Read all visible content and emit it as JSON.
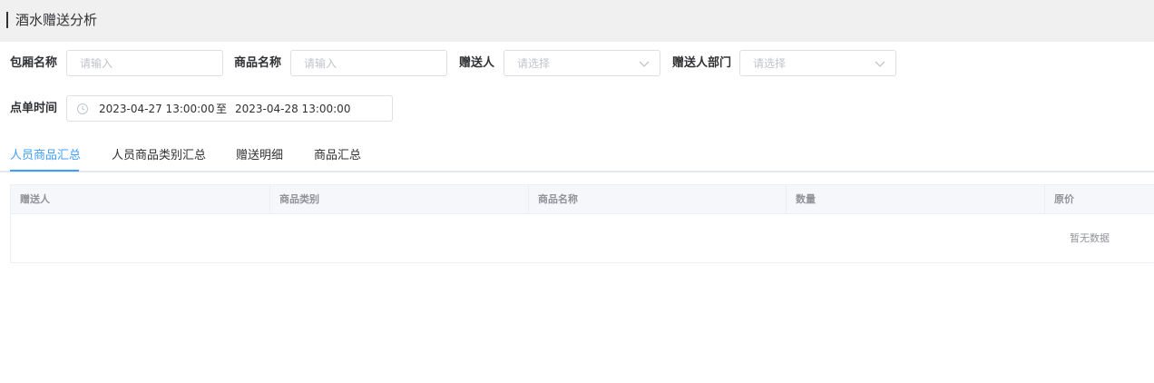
{
  "page": {
    "title": "酒水赠送分析"
  },
  "filters": {
    "room_name": {
      "label": "包厢名称",
      "placeholder": "请输入"
    },
    "product_name": {
      "label": "商品名称",
      "placeholder": "请输入"
    },
    "giver": {
      "label": "赠送人",
      "placeholder": "请选择"
    },
    "giver_dept": {
      "label": "赠送人部门",
      "placeholder": "请选择"
    },
    "order_time": {
      "label": "点单时间",
      "start": "2023-04-27 13:00:00",
      "separator": "至",
      "end": "2023-04-28 13:00:00"
    }
  },
  "tabs": [
    {
      "label": "人员商品汇总",
      "active": true
    },
    {
      "label": "人员商品类别汇总",
      "active": false
    },
    {
      "label": "赠送明细",
      "active": false
    },
    {
      "label": "商品汇总",
      "active": false
    }
  ],
  "table": {
    "columns": [
      "赠送人",
      "商品类别",
      "商品名称",
      "数量",
      "原价"
    ],
    "empty_text": "暂无数据"
  },
  "colors": {
    "accent": "#409eff",
    "header_bg": "#f0f0f0",
    "table_head_bg": "#f5f7fa"
  },
  "icons": {
    "select": "chevron-down-icon",
    "date": "clock-icon"
  }
}
